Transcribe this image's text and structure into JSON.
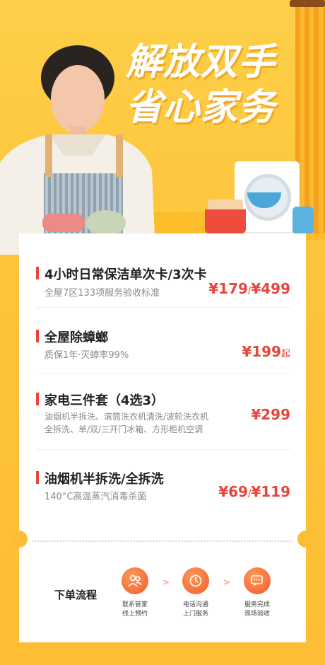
{
  "headline": {
    "line1": "解放双手",
    "line2": "省心家务"
  },
  "services": [
    {
      "title": "4小时日常保洁单次卡/3次卡",
      "desc": "全屋7区133项服务验收标准",
      "price_parts": [
        "¥179",
        "/",
        "¥499"
      ]
    },
    {
      "title": "全屋除蟑螂",
      "desc": "质保1年·灭蟑率99%",
      "price_parts": [
        "¥199",
        "起"
      ]
    },
    {
      "title": "家电三件套（4选3）",
      "desc_line1": "油烟机半拆洗、滚筒洗衣机清洗/波轮洗衣机",
      "desc_line2": "全拆洗、单/双/三开门冰箱、方形柜机空调",
      "price_parts": [
        "¥299"
      ]
    },
    {
      "title": "油烟机半拆洗/全拆洗",
      "desc": "140°C高温蒸汽消毒杀菌",
      "price_parts": [
        "¥69",
        "/",
        "¥119"
      ]
    }
  ],
  "flow": {
    "label": "下单流程",
    "steps": [
      {
        "line1": "联系管家",
        "line2": "线上预约",
        "icon": "people-icon"
      },
      {
        "line1": "电话沟通",
        "line2": "上门服务",
        "icon": "clock-icon"
      },
      {
        "line1": "服务完成",
        "line2": "现场验收",
        "icon": "chat-check-icon"
      }
    ],
    "arrow": ">"
  },
  "colors": {
    "accent": "#e8453c",
    "background": "#fdc53c",
    "step_circle": "#f05a2b"
  }
}
